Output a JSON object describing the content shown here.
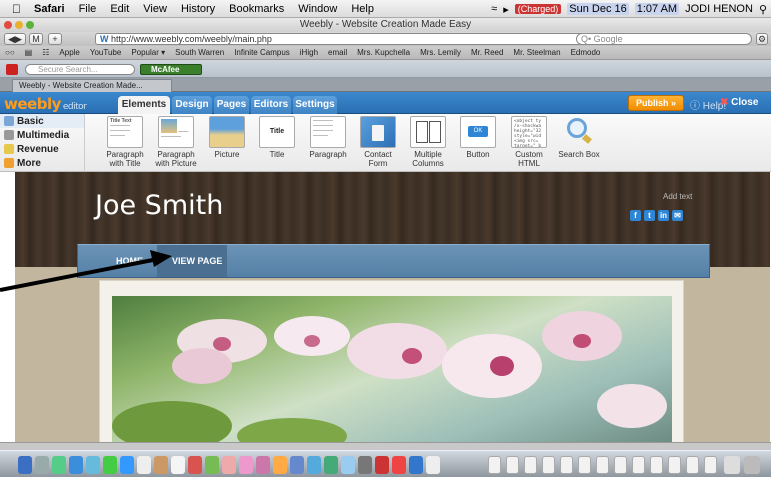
{
  "menubar": {
    "app_name": "Safari",
    "items": [
      "File",
      "Edit",
      "View",
      "History",
      "Bookmarks",
      "Window",
      "Help"
    ],
    "battery": "(Charged)",
    "date": "Sun Dec 16",
    "time": "1:07 AM",
    "user": "JODI HENON"
  },
  "window": {
    "title": "Weebly - Website Creation Made Easy"
  },
  "toolbar": {
    "url": "http://www.weebly.com/weebly/main.php",
    "search_placeholder": "Q• Google",
    "add_label": "+"
  },
  "bookmarks": [
    "Apple",
    "YouTube",
    "Popular ▾",
    "South Warren",
    "Infinite Campus",
    "iHigh",
    "email",
    "Mrs. Kupchella",
    "Mrs. Lemily",
    "Mr. Reed",
    "Mr. Steelman",
    "Edmodo"
  ],
  "security": {
    "search_placeholder": "Secure Search...",
    "mcafee_label": "McAfee"
  },
  "browser_tab": {
    "label": "Weebly - Website Creation Made..."
  },
  "weebly_bar": {
    "logo": "weebly",
    "logo_suffix": "editor",
    "tabs": [
      "Elements",
      "Design",
      "Pages",
      "Editors",
      "Settings"
    ],
    "publish": "Publish »",
    "help": "Help!",
    "close": "Close"
  },
  "categories": [
    "Basic",
    "Multimedia",
    "Revenue",
    "More"
  ],
  "elements": [
    {
      "label": "Paragraph with Title",
      "line1": "Paragraph",
      "line2": "with Title"
    },
    {
      "label": "Paragraph with Picture",
      "line1": "Paragraph",
      "line2": "with Picture"
    },
    {
      "label": "Picture",
      "line1": "Picture",
      "line2": ""
    },
    {
      "label": "Title",
      "line1": "Title",
      "line2": ""
    },
    {
      "label": "Paragraph",
      "line1": "Paragraph",
      "line2": ""
    },
    {
      "label": "Contact Form",
      "line1": "Contact",
      "line2": "Form"
    },
    {
      "label": "Multiple Columns",
      "line1": "Multiple",
      "line2": "Columns"
    },
    {
      "label": "Button",
      "line1": "Button",
      "line2": ""
    },
    {
      "label": "Custom HTML",
      "line1": "Custom",
      "line2": "HTML"
    },
    {
      "label": "Search Box",
      "line1": "Search Box",
      "line2": ""
    }
  ],
  "element_thumbs": {
    "title_text": "Title Text",
    "ok": "OK",
    "code": "<object ty\n/x-shockwa\nheight=\"32\nstyle=\"wid\n<img src=\ntarget=\"_b"
  },
  "site": {
    "name": "Joe Smith",
    "add_text": "Add text",
    "social": [
      "f",
      "t",
      "in",
      "✉"
    ],
    "nav": [
      "HOME",
      "VIEW PAGE"
    ]
  }
}
